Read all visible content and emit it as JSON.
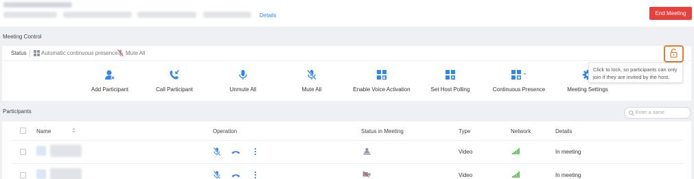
{
  "header": {
    "details_label": "Details",
    "end_meeting_label": "End Meeting"
  },
  "meeting_control": {
    "section_label": "Meeting Control",
    "status_label": "Status",
    "presence_mode": "Automatic continuous presence",
    "mute_state": "Mute All",
    "lock_tooltip": "Click to lock, so participants can only join if they are invited by the host.",
    "controls": [
      {
        "label": "Add Participant",
        "icon": "add-participant-icon"
      },
      {
        "label": "Call Participant",
        "icon": "call-participant-icon"
      },
      {
        "label": "Unmute All",
        "icon": "microphone-icon"
      },
      {
        "label": "Mute All",
        "icon": "microphone-muted-icon"
      },
      {
        "label": "Enable Voice Activation",
        "icon": "voice-activation-icon"
      },
      {
        "label": "Set Host Polling",
        "icon": "host-polling-icon"
      },
      {
        "label": "Continuous Presence",
        "icon": "continuous-presence-icon"
      },
      {
        "label": "Meeting Settings",
        "icon": "gear-icon"
      }
    ]
  },
  "participants": {
    "section_label": "Participants",
    "search_placeholder": "Enter a name",
    "columns": {
      "name": "Name",
      "operation": "Operation",
      "status": "Status in Meeting",
      "type": "Type",
      "network": "Network",
      "details": "Details"
    },
    "rows": [
      {
        "type": "Video",
        "details": "In meeting",
        "status_icon": "host-icon"
      },
      {
        "type": "Video",
        "details": "In meeting",
        "status_icon": "camera-off-icon"
      }
    ]
  },
  "colors": {
    "accent": "#2e86f2",
    "danger": "#e8403d",
    "lock_highlight": "#e8782a",
    "network_good": "#3cb53c"
  }
}
